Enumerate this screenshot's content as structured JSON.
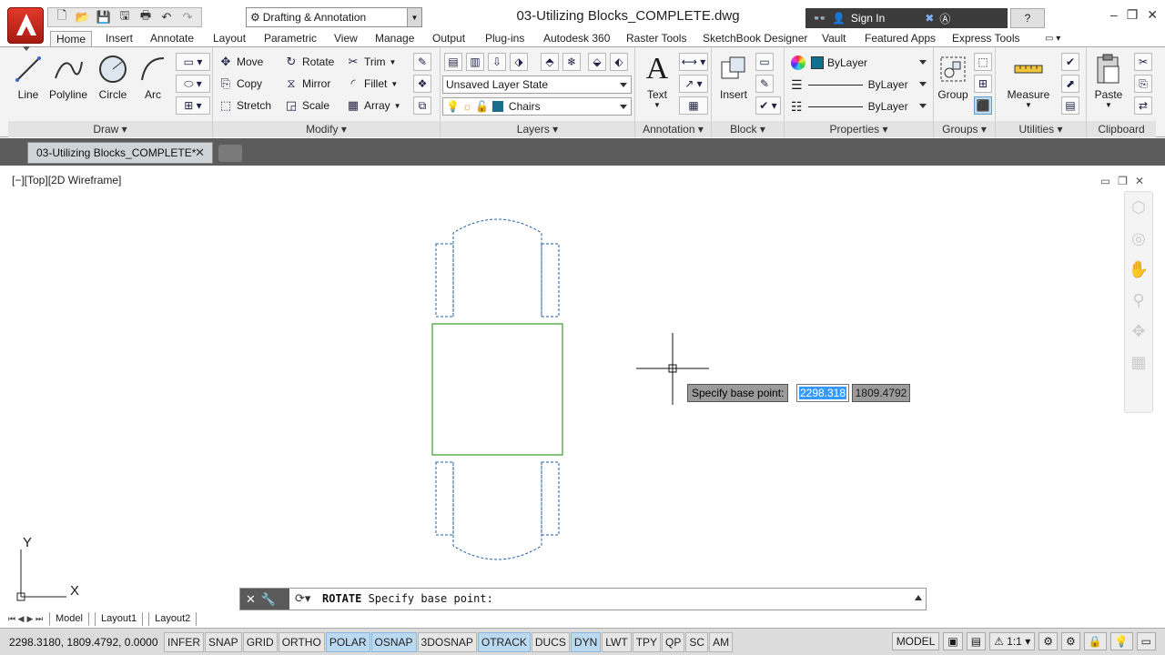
{
  "title_bar": {
    "document_title": "03-Utilizing Blocks_COMPLETE.dwg",
    "workspace": "Drafting & Annotation",
    "sign_in": "Sign In"
  },
  "ribbon_tabs": [
    "Home",
    "Insert",
    "Annotate",
    "Layout",
    "Parametric",
    "View",
    "Manage",
    "Output",
    "Plug-ins",
    "Autodesk 360",
    "Raster Tools",
    "SketchBook Designer",
    "Vault",
    "Featured Apps",
    "Express Tools"
  ],
  "draw_panel": {
    "title": "Draw",
    "line": "Line",
    "polyline": "Polyline",
    "circle": "Circle",
    "arc": "Arc"
  },
  "modify_panel": {
    "title": "Modify",
    "move": "Move",
    "copy": "Copy",
    "stretch": "Stretch",
    "rotate": "Rotate",
    "mirror": "Mirror",
    "scale": "Scale",
    "trim": "Trim",
    "fillet": "Fillet",
    "array": "Array"
  },
  "layers_panel": {
    "title": "Layers",
    "layer_state": "Unsaved Layer State",
    "current_layer": "Chairs",
    "layer_color": "#1a6e8a"
  },
  "annotation_panel": {
    "title": "Annotation",
    "text": "Text"
  },
  "block_panel": {
    "title": "Block",
    "insert": "Insert"
  },
  "properties_panel": {
    "title": "Properties",
    "color": "ByLayer",
    "linetype": "ByLayer",
    "lineweight": "ByLayer",
    "color_swatch": "#0e6f8f"
  },
  "groups_panel": {
    "title": "Groups",
    "group": "Group"
  },
  "utilities_panel": {
    "title": "Utilities",
    "measure": "Measure"
  },
  "clipboard_panel": {
    "title": "Clipboard",
    "paste": "Paste"
  },
  "file_tab": {
    "label": "03-Utilizing Blocks_COMPLETE*"
  },
  "viewport": {
    "controls": "[−][Top][2D Wireframe]"
  },
  "dynamic_input": {
    "prompt": "Specify base point:",
    "x_value": "2298.318",
    "y_value": "1809.4792"
  },
  "command_line": {
    "command": "ROTATE",
    "prompt": " Specify base point:"
  },
  "layout_tabs": [
    "Model",
    "Layout1",
    "Layout2"
  ],
  "status_bar": {
    "coordinates": "2298.3180, 1809.4792, 0.0000",
    "toggles": [
      {
        "label": "INFER",
        "on": false
      },
      {
        "label": "SNAP",
        "on": false
      },
      {
        "label": "GRID",
        "on": false
      },
      {
        "label": "ORTHO",
        "on": false
      },
      {
        "label": "POLAR",
        "on": true
      },
      {
        "label": "OSNAP",
        "on": true
      },
      {
        "label": "3DOSNAP",
        "on": false
      },
      {
        "label": "OTRACK",
        "on": true
      },
      {
        "label": "DUCS",
        "on": false
      },
      {
        "label": "DYN",
        "on": true
      },
      {
        "label": "LWT",
        "on": false
      },
      {
        "label": "TPY",
        "on": false
      },
      {
        "label": "QP",
        "on": false
      },
      {
        "label": "SC",
        "on": false
      },
      {
        "label": "AM",
        "on": false
      }
    ],
    "space": "MODEL",
    "annotation_scale": "1:1"
  },
  "ucs": {
    "x_label": "X",
    "y_label": "Y"
  },
  "colors": {
    "selected_object": "#3a9d23",
    "dashed_object": "#1f5fa8",
    "accent": "#3399ff"
  }
}
